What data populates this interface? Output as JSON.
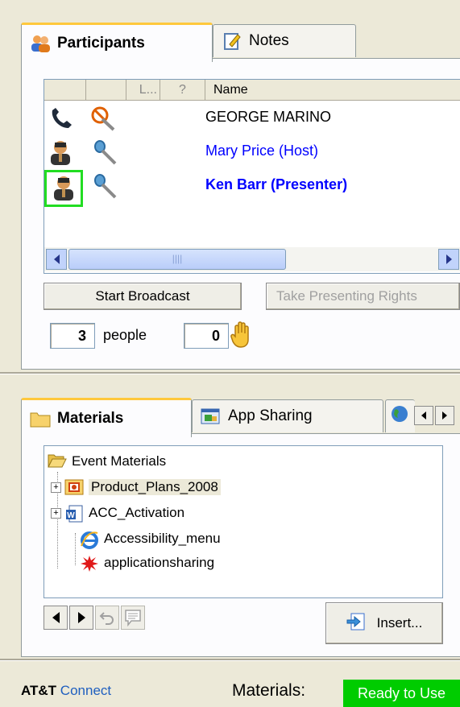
{
  "participants_panel": {
    "tabs": [
      {
        "label": "Participants",
        "icon": "people-icon",
        "active": true
      },
      {
        "label": "Notes",
        "icon": "notes-icon",
        "active": false
      }
    ],
    "columns": [
      "",
      "",
      "L...",
      "?",
      "Name"
    ],
    "rows": [
      {
        "name": "GEORGE MARINO",
        "icon1": "phone-icon",
        "icon2": "mute-mic-icon",
        "color": "#000000",
        "bold": false,
        "highlight": false
      },
      {
        "name": "Mary Price (Host)",
        "icon1": "person-icon",
        "icon2": "microphone-icon",
        "color": "#0000ff",
        "bold": false,
        "highlight": false
      },
      {
        "name": "Ken Barr (Presenter)",
        "icon1": "person-icon",
        "icon2": "microphone-icon",
        "color": "#0000ff",
        "bold": true,
        "highlight": true
      }
    ],
    "start_broadcast": "Start Broadcast",
    "take_presenting_rights": "Take Presenting Rights",
    "people_count": "3",
    "people_label": "people",
    "hands_count": "0"
  },
  "materials_panel": {
    "tabs": [
      {
        "label": "Materials",
        "icon": "folder-icon",
        "active": true
      },
      {
        "label": "App Sharing",
        "icon": "app-sharing-icon",
        "active": false
      }
    ],
    "tree": {
      "root": "Event Materials",
      "items": [
        {
          "label": "Product_Plans_2008",
          "icon": "presentation-icon",
          "expandable": true,
          "selected": true
        },
        {
          "label": "ACC_Activation",
          "icon": "word-document-icon",
          "expandable": true,
          "selected": false
        },
        {
          "label": "Accessibility_menu",
          "icon": "internet-explorer-icon",
          "expandable": false,
          "selected": false
        },
        {
          "label": "applicationsharing",
          "icon": "app-sharing-splat-icon",
          "expandable": false,
          "selected": false
        }
      ]
    },
    "insert_label": "Insert..."
  },
  "status_bar": {
    "brand_bold": "AT&T",
    "brand_rest": "Connect",
    "materials_label": "Materials:",
    "status": "Ready to Use",
    "status_color": "#00cc00"
  }
}
